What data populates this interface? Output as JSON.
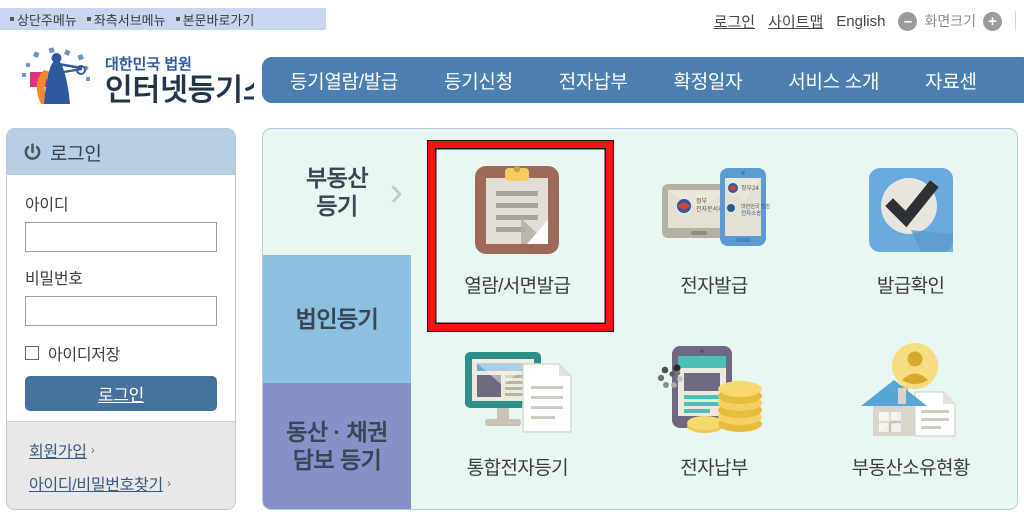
{
  "skip_links": [
    {
      "label": "상단주메뉴"
    },
    {
      "label": "좌측서브메뉴"
    },
    {
      "label": "본문바로가기"
    }
  ],
  "util_nav": {
    "links": [
      {
        "label": "로그인",
        "name": "login-link"
      },
      {
        "label": "사이트맵",
        "name": "sitemap-link"
      },
      {
        "label": "English",
        "name": "english-link"
      }
    ],
    "zoom": {
      "minus": "–",
      "label": "화면크기",
      "plus": "+"
    }
  },
  "logo": {
    "top_text": "대한민국 법원",
    "main_text": "인터넷등기소"
  },
  "main_nav": {
    "items": [
      {
        "label": "등기열람/발급"
      },
      {
        "label": "등기신청"
      },
      {
        "label": "전자납부"
      },
      {
        "label": "확정일자"
      },
      {
        "label": "서비스 소개"
      },
      {
        "label": "자료센"
      }
    ],
    "background": "#4a7fb0"
  },
  "sidebar": {
    "header": {
      "title": "로그인",
      "icon": "power-icon"
    },
    "id_field": {
      "label": "아이디",
      "value": "",
      "placeholder": ""
    },
    "pw_field": {
      "label": "비밀번호",
      "value": "",
      "placeholder": ""
    },
    "remember": {
      "label": "아이디저장",
      "checked": false
    },
    "login_button": {
      "label": "로그인"
    },
    "footer_links": [
      {
        "label": "회원가입",
        "chevron": "›"
      },
      {
        "label": "아이디/비밀번호찾기",
        "chevron": "›"
      }
    ]
  },
  "panel": {
    "categories": [
      {
        "label": "부동산\n등기",
        "active": true,
        "color": "#e8f7f2"
      },
      {
        "label": "법인등기",
        "active": false,
        "color": "#8bc0de"
      },
      {
        "label": "동산 · 채권\n담보 등기",
        "active": false,
        "color": "#8691ca"
      }
    ],
    "tiles": [
      {
        "label": "열람/서면발급",
        "icon": "clipboard-icon",
        "highlighted": true
      },
      {
        "label": "전자발급",
        "icon": "devices-icon",
        "highlighted": false
      },
      {
        "label": "발급확인",
        "icon": "checkmark-icon",
        "highlighted": false
      },
      {
        "label": "통합전자등기",
        "icon": "monitor-document-icon",
        "highlighted": false
      },
      {
        "label": "전자납부",
        "icon": "tablet-coins-icon",
        "highlighted": false
      },
      {
        "label": "부동산소유현황",
        "icon": "house-search-icon",
        "highlighted": false
      }
    ],
    "highlight_color": "#f01414"
  },
  "cursor": {
    "type": "busy-cursor"
  }
}
